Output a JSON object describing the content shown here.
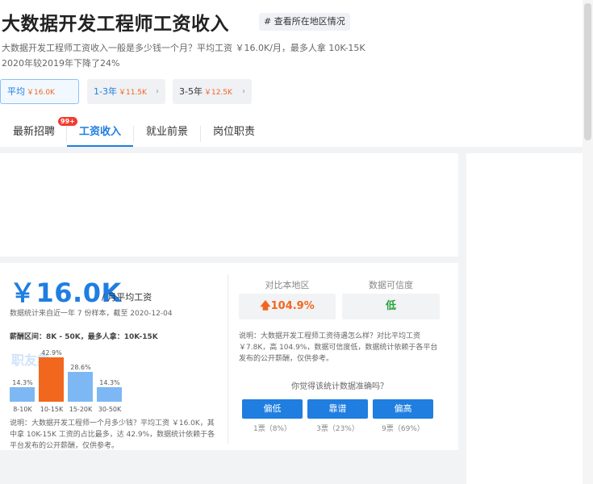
{
  "header": {
    "title": "大数据开发工程师工资收入",
    "region_tag": "# 查看所在地区情况",
    "summary_line1": "大数据开发工程师工资收入一般是多少钱一个月？平均工资 ￥16.0K/月，最多人拿 10K-15K",
    "summary_line2": "2020年较2019年下降了24%"
  },
  "levels": [
    {
      "label": "平均",
      "amount": "￥16.0K",
      "active": true
    },
    {
      "label": "1-3年",
      "amount": "￥11.5K",
      "active": false
    },
    {
      "label": "3-5年",
      "amount": "￥12.5K",
      "active": false
    }
  ],
  "tabs": [
    {
      "label": "最新招聘",
      "badge": "99+"
    },
    {
      "label": "工资收入"
    },
    {
      "label": "就业前景"
    },
    {
      "label": "岗位职责"
    }
  ],
  "salary": {
    "big_value": "￥16.0K",
    "suffix": "/ 月平均工资",
    "stat_note": "数据统计来自近一年 7 份样本，截至 2020-12-04",
    "range_line": "薪酬区间：8K - 50K，最多人拿：10K-15K",
    "watermark": "职友集",
    "description": "说明：大数据开发工程师一个月多少钱？平均工资 ￥16.0K，其中拿 10K-15K 工资的占比最多，达 42.9%，数据统计依赖于各平台发布的公开薪酬，仅供参考。"
  },
  "chart_data": {
    "type": "bar",
    "categories": [
      "8-10K",
      "10-15K",
      "15-20K",
      "30-50K"
    ],
    "values": [
      14.3,
      42.9,
      28.6,
      14.3
    ],
    "value_labels": [
      "14.3%",
      "42.9%",
      "28.6%",
      "14.3%"
    ],
    "colors": [
      "#7db8f5",
      "#f2671e",
      "#7db8f5",
      "#7db8f5"
    ],
    "ylim": [
      0,
      45
    ]
  },
  "compare": {
    "local_label": "对比本地区",
    "local_value": "104.9%",
    "trust_label": "数据可信度",
    "trust_value": "低",
    "description": "说明：大数据开发工程师工资待遇怎么样？对比平均工资 ￥7.8K，高 104.9%，数据可信度低，数据统计依赖于各平台发布的公开薪酬，仅供参考。",
    "question": "你觉得该统计数据准确吗？",
    "votes": [
      {
        "label": "偏低",
        "count": "1票（8%）"
      },
      {
        "label": "靠谱",
        "count": "3票（23%）"
      },
      {
        "label": "偏高",
        "count": "9票（69%）"
      }
    ]
  },
  "colors": {
    "accent": "#1f7ee0",
    "orange": "#f2671e",
    "green": "#27a33c",
    "badge": "#f23b30"
  }
}
